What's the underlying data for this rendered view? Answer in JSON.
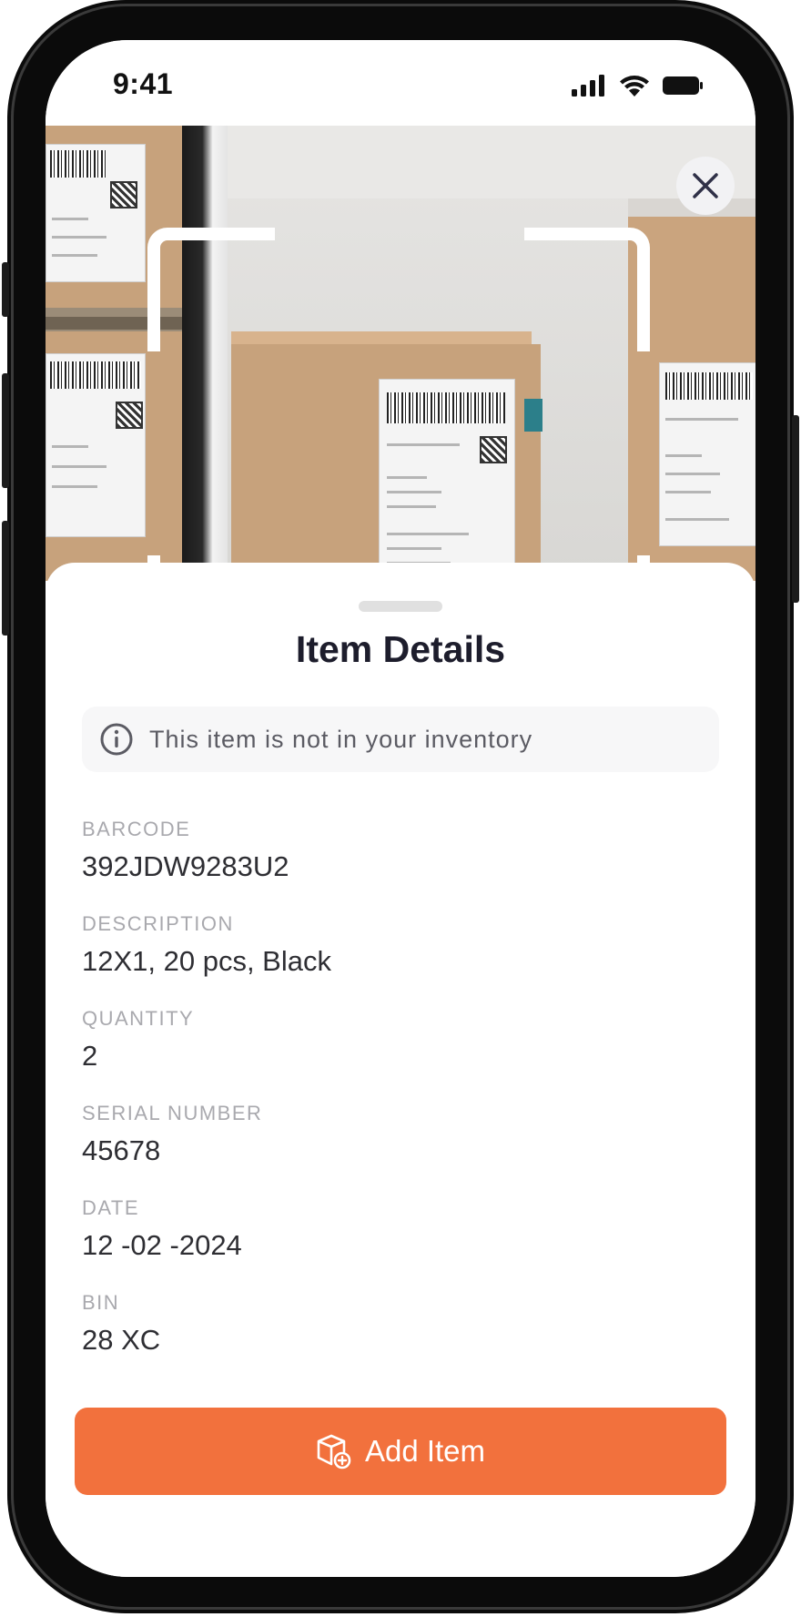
{
  "status_bar": {
    "time": "9:41",
    "icons": [
      "signal-icon",
      "wifi-icon",
      "battery-icon"
    ]
  },
  "scanner": {
    "close_icon": "close-icon"
  },
  "sheet": {
    "title": "Item Details",
    "notice": {
      "icon": "info-icon",
      "text": "This item is not in your inventory"
    },
    "fields": [
      {
        "label": "BARCODE",
        "value": "392JDW9283U2"
      },
      {
        "label": "DESCRIPTION",
        "value": "12X1, 20 pcs, Black"
      },
      {
        "label": "QUANTITY",
        "value": "2"
      },
      {
        "label": "SERIAL NUMBER",
        "value": "45678"
      },
      {
        "label": "DATE",
        "value": "12 -02 -2024"
      },
      {
        "label": "BIN",
        "value": "28 XC"
      }
    ],
    "primary_button": {
      "label": "Add Item",
      "icon": "box-add-icon"
    }
  },
  "colors": {
    "accent": "#F2713D",
    "title": "#1D1D2C",
    "label": "#A9A9AE",
    "value": "#2E2E33"
  }
}
